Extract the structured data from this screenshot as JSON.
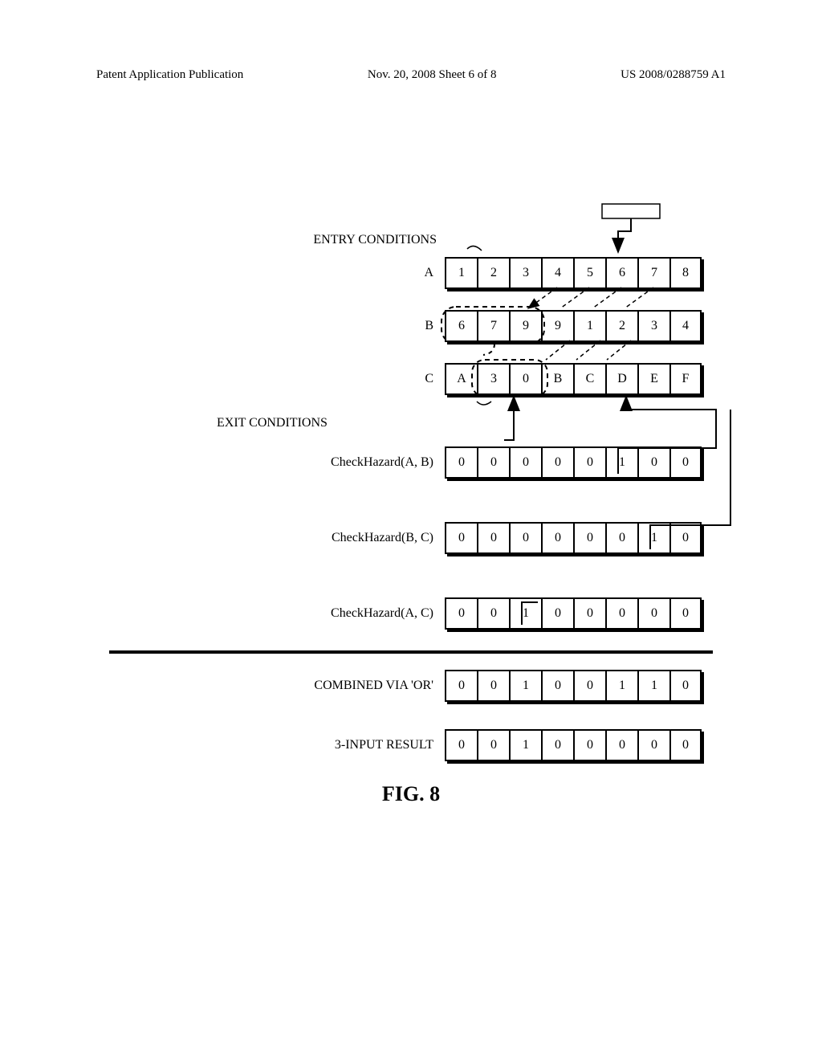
{
  "header": {
    "left": "Patent Application Publication",
    "center": "Nov. 20, 2008  Sheet 6 of 8",
    "right": "US 2008/0288759 A1"
  },
  "labels": {
    "entry": "ENTRY CONDITIONS",
    "exit": "EXIT CONDITIONS",
    "rowA": "A",
    "rowB": "B",
    "rowC": "C",
    "hazAB": "CheckHazard(A, B)",
    "hazBC": "CheckHazard(B, C)",
    "hazAC": "CheckHazard(A, C)",
    "combined": "COMBINED VIA 'OR'",
    "result3": "3-INPUT RESULT",
    "figcap": "FIG. 8"
  },
  "rows": {
    "A": [
      "1",
      "2",
      "3",
      "4",
      "5",
      "6",
      "7",
      "8"
    ],
    "B": [
      "6",
      "7",
      "9",
      "9",
      "1",
      "2",
      "3",
      "4"
    ],
    "C": [
      "A",
      "3",
      "0",
      "B",
      "C",
      "D",
      "E",
      "F"
    ],
    "hazAB": [
      "0",
      "0",
      "0",
      "0",
      "0",
      "1",
      "0",
      "0"
    ],
    "hazBC": [
      "0",
      "0",
      "0",
      "0",
      "0",
      "0",
      "1",
      "0"
    ],
    "hazAC": [
      "0",
      "0",
      "1",
      "0",
      "0",
      "0",
      "0",
      "0"
    ],
    "combined": [
      "0",
      "0",
      "1",
      "0",
      "0",
      "1",
      "1",
      "0"
    ],
    "result3": [
      "0",
      "0",
      "1",
      "0",
      "0",
      "0",
      "0",
      "0"
    ]
  },
  "chart_data": {
    "type": "table",
    "title": "FIG. 8",
    "entry_conditions": {
      "A": [
        1,
        2,
        3,
        4,
        5,
        6,
        7,
        8
      ],
      "B": [
        6,
        7,
        9,
        9,
        1,
        2,
        3,
        4
      ],
      "C": [
        "A",
        3,
        0,
        "B",
        "C",
        "D",
        "E",
        "F"
      ]
    },
    "exit_conditions_annotation": "dashed groups span columns 1–3 of rows B and C",
    "check_hazard": {
      "A_B": [
        0,
        0,
        0,
        0,
        0,
        1,
        0,
        0
      ],
      "B_C": [
        0,
        0,
        0,
        0,
        0,
        0,
        1,
        0
      ],
      "A_C": [
        0,
        0,
        1,
        0,
        0,
        0,
        0,
        0
      ]
    },
    "combined_via_or": [
      0,
      0,
      1,
      0,
      0,
      1,
      1,
      0
    ],
    "three_input_result": [
      0,
      0,
      1,
      0,
      0,
      0,
      0,
      0
    ],
    "arrow_annotations": [
      "entry arrow points into column 6–7 area of row A from above",
      "CheckHazard(A,B) column 6 → entry conditions (top rows)",
      "CheckHazard(B,C) column 7 → entry conditions (top rows)",
      "CheckHazard(A,C) column 3 → exit conditions (rows B/C, left group)"
    ]
  }
}
